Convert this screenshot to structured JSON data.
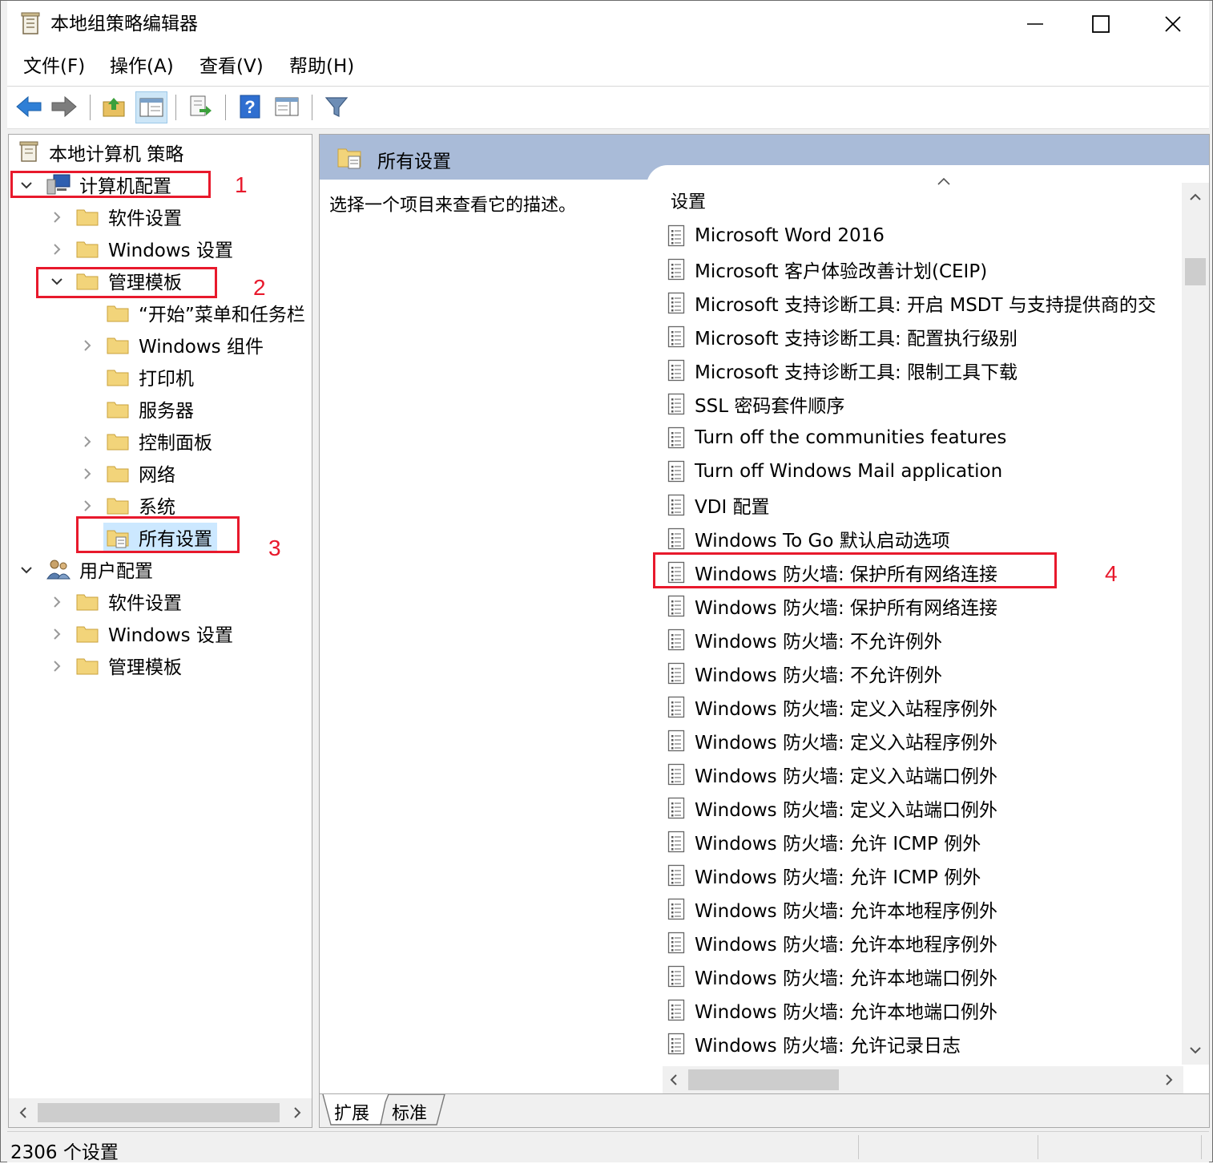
{
  "window": {
    "title": "本地组策略编辑器"
  },
  "menu": {
    "items": [
      "文件(F)",
      "操作(A)",
      "查看(V)",
      "帮助(H)"
    ]
  },
  "tree": {
    "root": "本地计算机 策略",
    "computer_config": "计算机配置",
    "cc_software": "软件设置",
    "cc_windows": "Windows 设置",
    "cc_admin": "管理模板",
    "at_start": "“开始”菜单和任务栏",
    "at_wincomp": "Windows 组件",
    "at_printer": "打印机",
    "at_server": "服务器",
    "at_controlpanel": "控制面板",
    "at_network": "网络",
    "at_system": "系统",
    "at_allsettings": "所有设置",
    "user_config": "用户配置",
    "uc_software": "软件设置",
    "uc_windows": "Windows 设置",
    "uc_admin": "管理模板"
  },
  "right": {
    "header": "所有设置",
    "description": "选择一个项目来查看它的描述。",
    "column_header": "设置",
    "rows": [
      "Microsoft Word 2016",
      "Microsoft 客户体验改善计划(CEIP)",
      "Microsoft 支持诊断工具: 开启 MSDT 与支持提供商的交",
      "Microsoft 支持诊断工具: 配置执行级别",
      "Microsoft 支持诊断工具: 限制工具下载",
      "SSL 密码套件顺序",
      "Turn off the communities features",
      "Turn off Windows Mail application",
      "VDI 配置",
      "Windows To Go 默认启动选项",
      "Windows 防火墙: 保护所有网络连接",
      "Windows 防火墙: 保护所有网络连接",
      "Windows 防火墙: 不允许例外",
      "Windows 防火墙: 不允许例外",
      "Windows 防火墙: 定义入站程序例外",
      "Windows 防火墙: 定义入站程序例外",
      "Windows 防火墙: 定义入站端口例外",
      "Windows 防火墙: 定义入站端口例外",
      "Windows 防火墙: 允许 ICMP 例外",
      "Windows 防火墙: 允许 ICMP 例外",
      "Windows 防火墙: 允许本地程序例外",
      "Windows 防火墙: 允许本地程序例外",
      "Windows 防火墙: 允许本地端口例外",
      "Windows 防火墙: 允许本地端口例外",
      "Windows 防火墙: 允许记录日志"
    ],
    "tabs": [
      "扩展",
      "标准"
    ]
  },
  "status": {
    "text": "2306 个设置"
  },
  "annotations": [
    "1",
    "2",
    "3",
    "4"
  ],
  "colors": {
    "annotation": "#e8192c",
    "header_bar": "#a9bbd8",
    "folder": "#e8c060"
  },
  "icons": [
    "app-icon",
    "back-icon",
    "forward-icon",
    "up-folder-icon",
    "show-hide-tree-icon",
    "export-icon",
    "help-icon",
    "view-icon",
    "filter-icon",
    "folder-icon",
    "document-icon",
    "computer-icon",
    "user-icon"
  ]
}
